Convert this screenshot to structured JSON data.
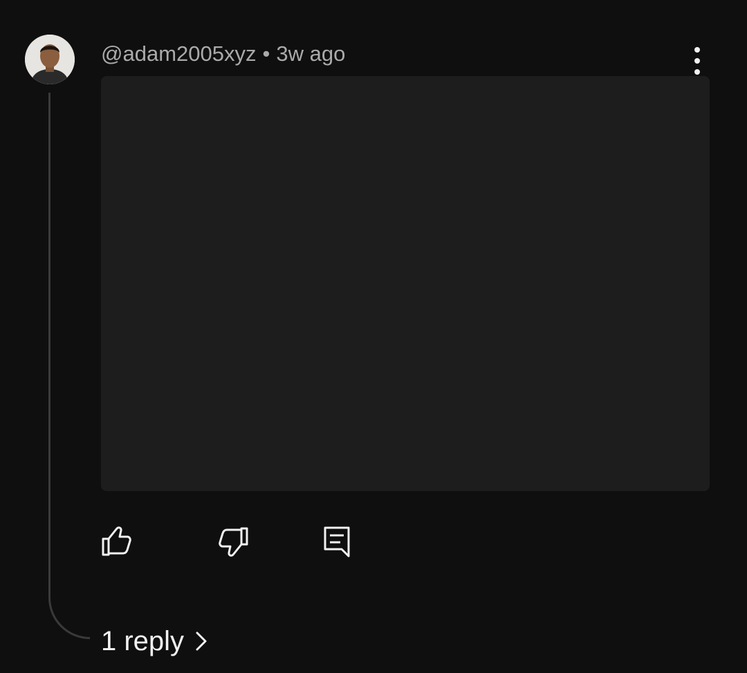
{
  "comment": {
    "author": "@adam2005xyz",
    "time": "3w ago",
    "separator": "•",
    "avatar_icon": "user-photo-avatar"
  },
  "actions": {
    "like_icon": "thumbs-up-icon",
    "dislike_icon": "thumbs-down-icon",
    "reply_icon": "reply-comment-icon"
  },
  "replies": {
    "label": "1 reply",
    "icon": "chevron-right-icon"
  },
  "colors": {
    "background": "#0f0f0f",
    "text": "#f1f1f1",
    "muted": "#aaaaaa",
    "thread_line": "#3a3a3a"
  }
}
